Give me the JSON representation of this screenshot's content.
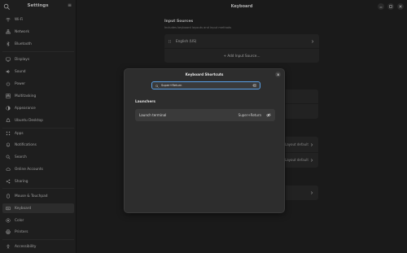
{
  "sidebar": {
    "title": "Settings",
    "items": [
      {
        "label": "Wi-Fi",
        "icon": "wifi-icon"
      },
      {
        "label": "Network",
        "icon": "network-icon"
      },
      {
        "label": "Bluetooth",
        "icon": "bluetooth-icon"
      },
      {
        "label": "Displays",
        "icon": "display-icon"
      },
      {
        "label": "Sound",
        "icon": "sound-icon"
      },
      {
        "label": "Power",
        "icon": "power-icon"
      },
      {
        "label": "Multitasking",
        "icon": "multitasking-icon"
      },
      {
        "label": "Appearance",
        "icon": "appearance-icon"
      },
      {
        "label": "Ubuntu Desktop",
        "icon": "ubuntu-desktop-icon"
      },
      {
        "label": "Apps",
        "icon": "apps-icon"
      },
      {
        "label": "Notifications",
        "icon": "bell-icon"
      },
      {
        "label": "Search",
        "icon": "search-icon"
      },
      {
        "label": "Online Accounts",
        "icon": "cloud-icon"
      },
      {
        "label": "Sharing",
        "icon": "share-icon"
      },
      {
        "label": "Mouse & Touchpad",
        "icon": "mouse-icon"
      },
      {
        "label": "Keyboard",
        "icon": "keyboard-icon"
      },
      {
        "label": "Color",
        "icon": "color-icon"
      },
      {
        "label": "Printers",
        "icon": "printer-icon"
      },
      {
        "label": "Accessibility",
        "icon": "accessibility-icon"
      }
    ],
    "active": "Keyboard"
  },
  "main": {
    "title": "Keyboard",
    "input_sources": {
      "title": "Input Sources",
      "subtitle": "Includes keyboard layouts and input methods",
      "layout": "English (US)",
      "add_label": "+ Add Input Source…"
    },
    "background_rows": [
      "Layout default",
      "Layout default"
    ]
  },
  "dialog": {
    "title": "Keyboard Shortcuts",
    "search_value": "Super+Return",
    "section": "Launchers",
    "shortcut": {
      "name": "Launch terminal",
      "accel": "Super+Return"
    }
  },
  "colors": {
    "accent": "#5aa0e6",
    "sidebar_bg": "#2a2a2a",
    "main_bg": "#242424",
    "dialog_bg": "#2d2d2d"
  }
}
